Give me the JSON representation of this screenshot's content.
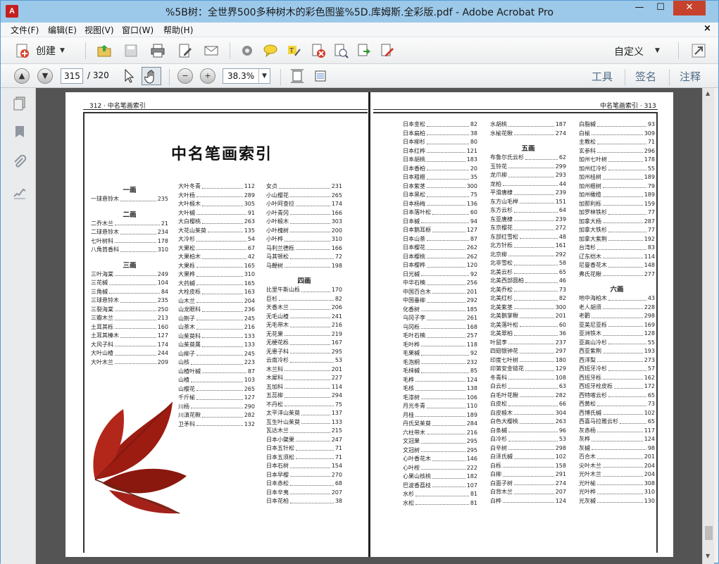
{
  "window": {
    "title": "%5B树：全世界500多种树木的彩色图鉴%5D.库姆斯.全彩版.pdf - Adobe Acrobat Pro",
    "min": "—",
    "max": "☐",
    "close": "✕"
  },
  "menu": [
    "文件(F)",
    "编辑(E)",
    "视图(V)",
    "窗口(W)",
    "帮助(H)"
  ],
  "menu_close": "×",
  "toolbar": {
    "create_label": "创建",
    "custom_label": "自定义"
  },
  "nav": {
    "page_value": "315",
    "page_total": "/ 320",
    "zoom_value": "38.3%"
  },
  "panels": {
    "tools": "工具",
    "sign": "签名",
    "comment": "注释"
  },
  "left_page": {
    "header": "312 · 中名笔画索引",
    "title": "中名笔画索引",
    "col1": [
      {
        "h": "一画"
      },
      {
        "n": "一球悬铃木",
        "p": "235"
      },
      {
        "gap": true
      },
      {
        "h": "二画"
      },
      {
        "n": "二乔木兰",
        "p": "21"
      },
      {
        "n": "二球悬铃木",
        "p": "234"
      },
      {
        "n": "七叶树科",
        "p": "178"
      },
      {
        "n": "八角茴香科",
        "p": "310"
      },
      {
        "gap": true
      },
      {
        "h": "三画"
      },
      {
        "n": "三叶海棠",
        "p": "249"
      },
      {
        "n": "三花槭",
        "p": "104"
      },
      {
        "n": "三角槭",
        "p": "84"
      },
      {
        "n": "三球悬铃木",
        "p": "235"
      },
      {
        "n": "三裂海棠",
        "p": "250"
      },
      {
        "n": "三瓣木兰",
        "p": "213"
      },
      {
        "n": "土耳其栎",
        "p": "160"
      },
      {
        "n": "土耳其榛木",
        "p": "127"
      },
      {
        "n": "大风子科",
        "p": "174"
      },
      {
        "n": "大叶山楂",
        "p": "244"
      },
      {
        "n": "大叶木兰",
        "p": "209"
      }
    ],
    "col2": [
      {
        "n": "大叶冬青",
        "p": "112"
      },
      {
        "n": "大叶杨",
        "p": "289"
      },
      {
        "n": "大叶椴木",
        "p": "305"
      },
      {
        "n": "大叶槭",
        "p": "91"
      },
      {
        "n": "大白樱桃",
        "p": "263"
      },
      {
        "n": "大花山茱萸",
        "p": "135"
      },
      {
        "n": "大冷杉",
        "p": "54"
      },
      {
        "n": "大果松",
        "p": "67"
      },
      {
        "n": "大果柏木",
        "p": "42"
      },
      {
        "n": "大果栎",
        "p": "165"
      },
      {
        "n": "大果桦",
        "p": "310"
      },
      {
        "n": "大药槭",
        "p": "165"
      },
      {
        "n": "大栓皮栎",
        "p": "163"
      },
      {
        "n": "山木兰",
        "p": "204"
      },
      {
        "n": "山龙眼科",
        "p": "236"
      },
      {
        "n": "山荆子",
        "p": "245"
      },
      {
        "n": "山茶木",
        "p": "216"
      },
      {
        "n": "山茱萸科",
        "p": "133"
      },
      {
        "n": "山茱萸属",
        "p": "133"
      },
      {
        "n": "山柳子",
        "p": "245"
      },
      {
        "n": "山核",
        "p": "223"
      },
      {
        "n": "山楂叶槭",
        "p": "87"
      },
      {
        "n": "山楂",
        "p": "103"
      },
      {
        "n": "山樱花",
        "p": "265"
      },
      {
        "n": "千斤榆",
        "p": "127"
      },
      {
        "n": "川杨",
        "p": "290"
      },
      {
        "n": "川滇花楸",
        "p": "282"
      },
      {
        "n": "卫矛科",
        "p": "132"
      }
    ],
    "col3": [
      {
        "n": "女贞",
        "p": "231"
      },
      {
        "n": "小山樱花",
        "p": "265"
      },
      {
        "n": "小叶阿查拉",
        "p": "174"
      },
      {
        "n": "小叶青冈",
        "p": "166"
      },
      {
        "n": "小叶椴木",
        "p": "303"
      },
      {
        "n": "小叶槐树",
        "p": "200"
      },
      {
        "n": "小叶桦",
        "p": "310"
      },
      {
        "n": "马利兰德栎",
        "p": "166"
      },
      {
        "n": "马其顿松",
        "p": "72"
      },
      {
        "n": "马鞭树",
        "p": "198"
      },
      {
        "gap": true
      },
      {
        "h": "四画"
      },
      {
        "n": "比里牛斯山栎",
        "p": "170"
      },
      {
        "n": "巨杉",
        "p": "82"
      },
      {
        "n": "天香木兰",
        "p": "206"
      },
      {
        "n": "无毛山楂",
        "p": "241"
      },
      {
        "n": "无毛带木",
        "p": "216"
      },
      {
        "n": "无花果",
        "p": "219"
      },
      {
        "n": "无梗花栎",
        "p": "167"
      },
      {
        "n": "无患子科",
        "p": "295"
      },
      {
        "n": "云南冷杉",
        "p": "53"
      },
      {
        "n": "木兰科",
        "p": "201"
      },
      {
        "n": "木犀科",
        "p": "227"
      },
      {
        "n": "五加科",
        "p": "114"
      },
      {
        "n": "五蕊柳",
        "p": "294"
      },
      {
        "n": "不丹松",
        "p": "75"
      },
      {
        "n": "太平洋山茱萸",
        "p": "137"
      },
      {
        "n": "互生叶山茱萸",
        "p": "133"
      },
      {
        "n": "瓦达木兰",
        "p": "215"
      },
      {
        "n": "日本小檗果",
        "p": "247"
      },
      {
        "n": "日本五针松",
        "p": "71"
      },
      {
        "n": "日本五须松",
        "p": "71"
      },
      {
        "n": "日本石树",
        "p": "154"
      },
      {
        "n": "日本早樱",
        "p": "270"
      },
      {
        "n": "日本赤松",
        "p": "68"
      },
      {
        "n": "日本辛夷",
        "p": "207"
      },
      {
        "n": "日本花柏",
        "p": "38"
      }
    ]
  },
  "right_page": {
    "header": "中名笔画索引 · 313",
    "col1": [
      {
        "n": "日本金松",
        "p": "82"
      },
      {
        "n": "日本扁柏",
        "p": "38"
      },
      {
        "n": "日本柳杉",
        "p": "80"
      },
      {
        "n": "日本红桦",
        "p": "121"
      },
      {
        "n": "日本胡桃",
        "p": "183"
      },
      {
        "n": "日本香柏",
        "p": "20"
      },
      {
        "n": "日本粗榧",
        "p": "35"
      },
      {
        "n": "日本紫茎",
        "p": "300"
      },
      {
        "n": "日本黑松",
        "p": "75"
      },
      {
        "n": "日本杨梅",
        "p": "136"
      },
      {
        "n": "日本落叶松",
        "p": "60"
      },
      {
        "n": "日本槭",
        "p": "94"
      },
      {
        "n": "日本鹅耳枥",
        "p": "127"
      },
      {
        "n": "日本山茶",
        "p": "87"
      },
      {
        "n": "日本樱花",
        "p": "262"
      },
      {
        "n": "日本樱桃",
        "p": "262"
      },
      {
        "n": "日本樱桦",
        "p": "120"
      },
      {
        "n": "日光槭",
        "p": "92"
      },
      {
        "n": "中华石楠",
        "p": "256"
      },
      {
        "n": "中国百合木",
        "p": "201"
      },
      {
        "n": "中国垂柳",
        "p": "292"
      },
      {
        "n": "化香树",
        "p": "185"
      },
      {
        "n": "乌冈子李",
        "p": "261"
      },
      {
        "n": "乌冈栎",
        "p": "168"
      },
      {
        "n": "毛叶石楠",
        "p": "257"
      },
      {
        "n": "毛叶桦",
        "p": "118"
      },
      {
        "n": "毛果槭",
        "p": "92"
      },
      {
        "n": "毛泡桐",
        "p": "232"
      },
      {
        "n": "毛梾槭",
        "p": "85"
      },
      {
        "n": "毛桦",
        "p": "124"
      },
      {
        "n": "毛核",
        "p": "138"
      },
      {
        "n": "毛漆树",
        "p": "106"
      },
      {
        "n": "月光冬青",
        "p": "110"
      },
      {
        "n": "月桂",
        "p": "189"
      },
      {
        "n": "丹氏吴茱萸",
        "p": "284"
      },
      {
        "n": "六柱带木",
        "p": "216"
      },
      {
        "n": "文冠果",
        "p": "295"
      },
      {
        "n": "文冠树",
        "p": "295"
      },
      {
        "n": "心叶香花木",
        "p": "146"
      },
      {
        "n": "心叶桉",
        "p": "222"
      },
      {
        "n": "心果山核桃",
        "p": "182"
      },
      {
        "n": "巴波香荔枝",
        "p": "107"
      },
      {
        "n": "水杉",
        "p": "81"
      },
      {
        "n": "水松",
        "p": "81"
      }
    ],
    "col2": [
      {
        "n": "水胡桃",
        "p": "187"
      },
      {
        "n": "水榆花楸",
        "p": "274"
      },
      {
        "gap": true
      },
      {
        "h": "五画"
      },
      {
        "n": "布鲁尔氏云杉",
        "p": "62"
      },
      {
        "n": "玉铃花",
        "p": "299"
      },
      {
        "n": "龙爪柳",
        "p": "293"
      },
      {
        "n": "龙柏",
        "p": "44"
      },
      {
        "n": "平滑唐棣",
        "p": "239"
      },
      {
        "n": "东方山毛榉",
        "p": "151"
      },
      {
        "n": "东方云杉",
        "p": "64"
      },
      {
        "n": "东亚唐棣",
        "p": "239"
      },
      {
        "n": "东京樱花",
        "p": "272"
      },
      {
        "n": "东部红雪松",
        "p": "48"
      },
      {
        "n": "北方针栎",
        "p": "161"
      },
      {
        "n": "北京柳",
        "p": "292"
      },
      {
        "n": "北非雪松",
        "p": "58"
      },
      {
        "n": "北美云杉",
        "p": "65"
      },
      {
        "n": "北美西部圆柏",
        "p": "46"
      },
      {
        "n": "北美乔松",
        "p": "73"
      },
      {
        "n": "北美红杉",
        "p": "82"
      },
      {
        "n": "北美紫茎",
        "p": "300"
      },
      {
        "n": "北美鹅掌楸",
        "p": "201"
      },
      {
        "n": "北美落叶松",
        "p": "60"
      },
      {
        "n": "北美翠柏",
        "p": "36"
      },
      {
        "n": "叶鼠李",
        "p": "237"
      },
      {
        "n": "四翅银钟花",
        "p": "297"
      },
      {
        "n": "印度七叶树",
        "p": "180"
      },
      {
        "n": "印第安金链花",
        "p": "129"
      },
      {
        "n": "冬青科",
        "p": "108"
      },
      {
        "n": "白云杉",
        "p": "63"
      },
      {
        "n": "白毛叶花楸",
        "p": "282"
      },
      {
        "n": "白皮松",
        "p": "66"
      },
      {
        "n": "白皮椴木",
        "p": "304"
      },
      {
        "n": "白色大樱桃",
        "p": "263"
      },
      {
        "n": "白条槭",
        "p": "96"
      },
      {
        "n": "白冷杉",
        "p": "53"
      },
      {
        "n": "白辛树",
        "p": "298"
      },
      {
        "n": "白泽氏槭",
        "p": "102"
      },
      {
        "n": "白栎",
        "p": "158"
      },
      {
        "n": "白柳",
        "p": "291"
      },
      {
        "n": "白面子树",
        "p": "274"
      },
      {
        "n": "白背木兰",
        "p": "207"
      },
      {
        "n": "白桦",
        "p": "124"
      }
    ],
    "col3": [
      {
        "n": "白脂槭",
        "p": "93"
      },
      {
        "n": "白榆",
        "p": "309"
      },
      {
        "n": "主教松",
        "p": "71"
      },
      {
        "n": "玄参科",
        "p": "296"
      },
      {
        "n": "加州七叶树",
        "p": "178"
      },
      {
        "n": "加州红冷杉",
        "p": "55"
      },
      {
        "n": "加州桂树",
        "p": "189"
      },
      {
        "n": "加州榧树",
        "p": "79"
      },
      {
        "n": "加州橄榄",
        "p": "189"
      },
      {
        "n": "加那利栎",
        "p": "159"
      },
      {
        "n": "加罗林铁杉",
        "p": "77"
      },
      {
        "n": "加拿大杨",
        "p": "287"
      },
      {
        "n": "加拿大铁杉",
        "p": "77"
      },
      {
        "n": "加拿大紫荆",
        "p": "192"
      },
      {
        "n": "台湾杉",
        "p": "83"
      },
      {
        "n": "辽东桤木",
        "p": "114"
      },
      {
        "n": "尼曼香花木",
        "p": "148"
      },
      {
        "n": "弗氏花楸",
        "p": "277"
      },
      {
        "gap": true
      },
      {
        "h": "六画"
      },
      {
        "n": "地中海柏木",
        "p": "43"
      },
      {
        "n": "老人胡须",
        "p": "228"
      },
      {
        "n": "老鹳",
        "p": "298"
      },
      {
        "n": "亚美尼亚栎",
        "p": "169"
      },
      {
        "n": "亚洲铁木",
        "p": "128"
      },
      {
        "n": "亚高山冷杉",
        "p": "55"
      },
      {
        "n": "西亚紫荆",
        "p": "193"
      },
      {
        "n": "西洋梨",
        "p": "273"
      },
      {
        "n": "西班牙冷杉",
        "p": "57"
      },
      {
        "n": "西班牙栎",
        "p": "162"
      },
      {
        "n": "西班牙栓皮栎",
        "p": "172"
      },
      {
        "n": "西特喀云杉",
        "p": "65"
      },
      {
        "n": "西黄松",
        "p": "73"
      },
      {
        "n": "西博氏槭",
        "p": "102"
      },
      {
        "n": "西喜马拉雅云杉",
        "p": "65"
      },
      {
        "n": "灰赤杨",
        "p": "117"
      },
      {
        "n": "灰桦",
        "p": "124"
      },
      {
        "n": "灰槭",
        "p": "98"
      },
      {
        "n": "百合木",
        "p": "201"
      },
      {
        "n": "尖叶木兰",
        "p": "204"
      },
      {
        "n": "光叶木兰",
        "p": "204"
      },
      {
        "n": "光叶榆",
        "p": "308"
      },
      {
        "n": "光叶桦",
        "p": "310"
      },
      {
        "n": "光灰槭",
        "p": "130"
      }
    ]
  },
  "colors": {
    "titlebar": "#9cc9ea",
    "doc_bg": "#545454",
    "leaf": "#9c1c12"
  }
}
